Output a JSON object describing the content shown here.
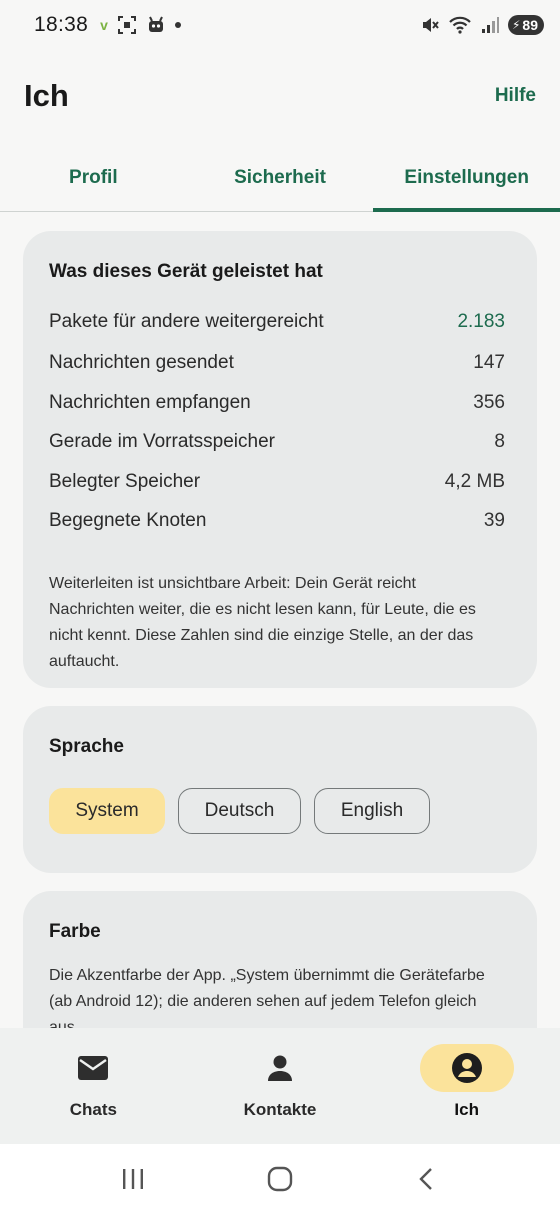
{
  "status_bar": {
    "time": "18:38",
    "battery_level": "89",
    "icons": [
      "vpn-v-icon",
      "screenshot-icon",
      "bot-icon",
      "dot-icon",
      "mute-icon",
      "wifi-icon",
      "signal-icon",
      "battery-icon"
    ]
  },
  "header": {
    "title": "Ich",
    "help_label": "Hilfe"
  },
  "tabs": [
    {
      "label": "Profil",
      "active": false
    },
    {
      "label": "Sicherheit",
      "active": false
    },
    {
      "label": "Einstellungen",
      "active": true
    }
  ],
  "stats_card": {
    "title": "Was dieses Gerät geleistet hat",
    "rows": [
      {
        "label": "Pakete für andere weitergereicht",
        "value": "2.183",
        "accent": true
      },
      {
        "label": "Nachrichten gesendet",
        "value": "147"
      },
      {
        "label": "Nachrichten empfangen",
        "value": "356"
      },
      {
        "label": "Gerade im Vorratsspeicher",
        "value": "8"
      },
      {
        "label": "Belegter Speicher",
        "value": "4,2 MB"
      },
      {
        "label": "Begegnete Knoten",
        "value": "39"
      }
    ],
    "note": "Weiterleiten ist unsichtbare Arbeit: Dein Gerät reicht Nachrichten weiter, die es nicht lesen kann, für Leute, die es nicht kennt. Diese Zahlen sind die einzige Stelle, an der das auftaucht."
  },
  "language_card": {
    "title": "Sprache",
    "options": [
      "System",
      "Deutsch",
      "English"
    ],
    "selected": "System"
  },
  "color_card": {
    "title": "Farbe",
    "description": "Die Akzentfarbe der App. „System übernimmt die Gerätefarbe (ab Android 12); die anderen sehen auf jedem Telefon gleich aus."
  },
  "bottom_nav": {
    "items": [
      {
        "label": "Chats",
        "icon": "mail-icon",
        "active": false
      },
      {
        "label": "Kontakte",
        "icon": "person-icon",
        "active": false
      },
      {
        "label": "Ich",
        "icon": "account-circle-icon",
        "active": true
      }
    ]
  },
  "colors": {
    "accent_green": "#1d6b4e",
    "selected_yellow": "#fbe39b",
    "card_bg": "#e8eaea",
    "page_bg": "#f7f7f6"
  }
}
